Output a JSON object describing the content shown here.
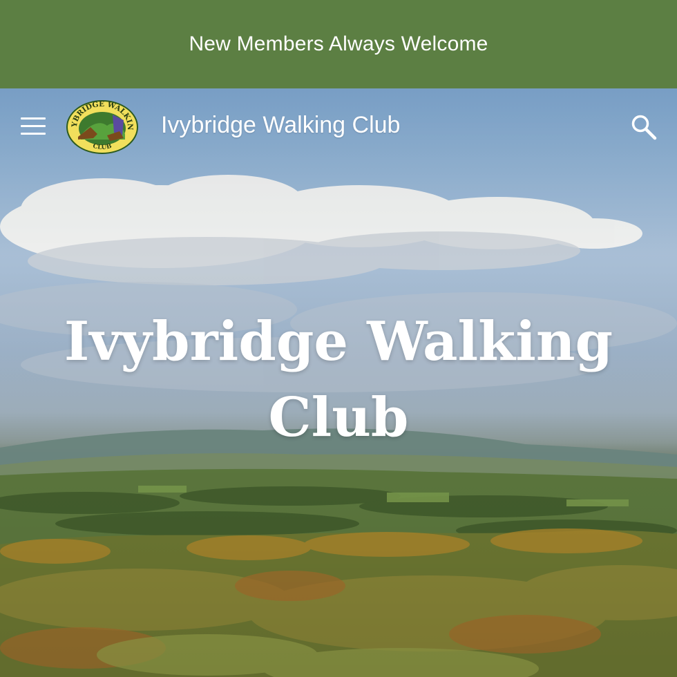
{
  "announcement": {
    "text": "New Members Always Welcome",
    "background": "#5c7f43"
  },
  "header": {
    "menu_icon": "hamburger-menu-icon",
    "logo": {
      "top_text": "IVYBRIDGE WALKING",
      "bottom_text": "CLUB"
    },
    "site_title": "Ivybridge Walking Club",
    "search_icon": "search-icon"
  },
  "hero": {
    "title": "Ivybridge Walking Club"
  }
}
